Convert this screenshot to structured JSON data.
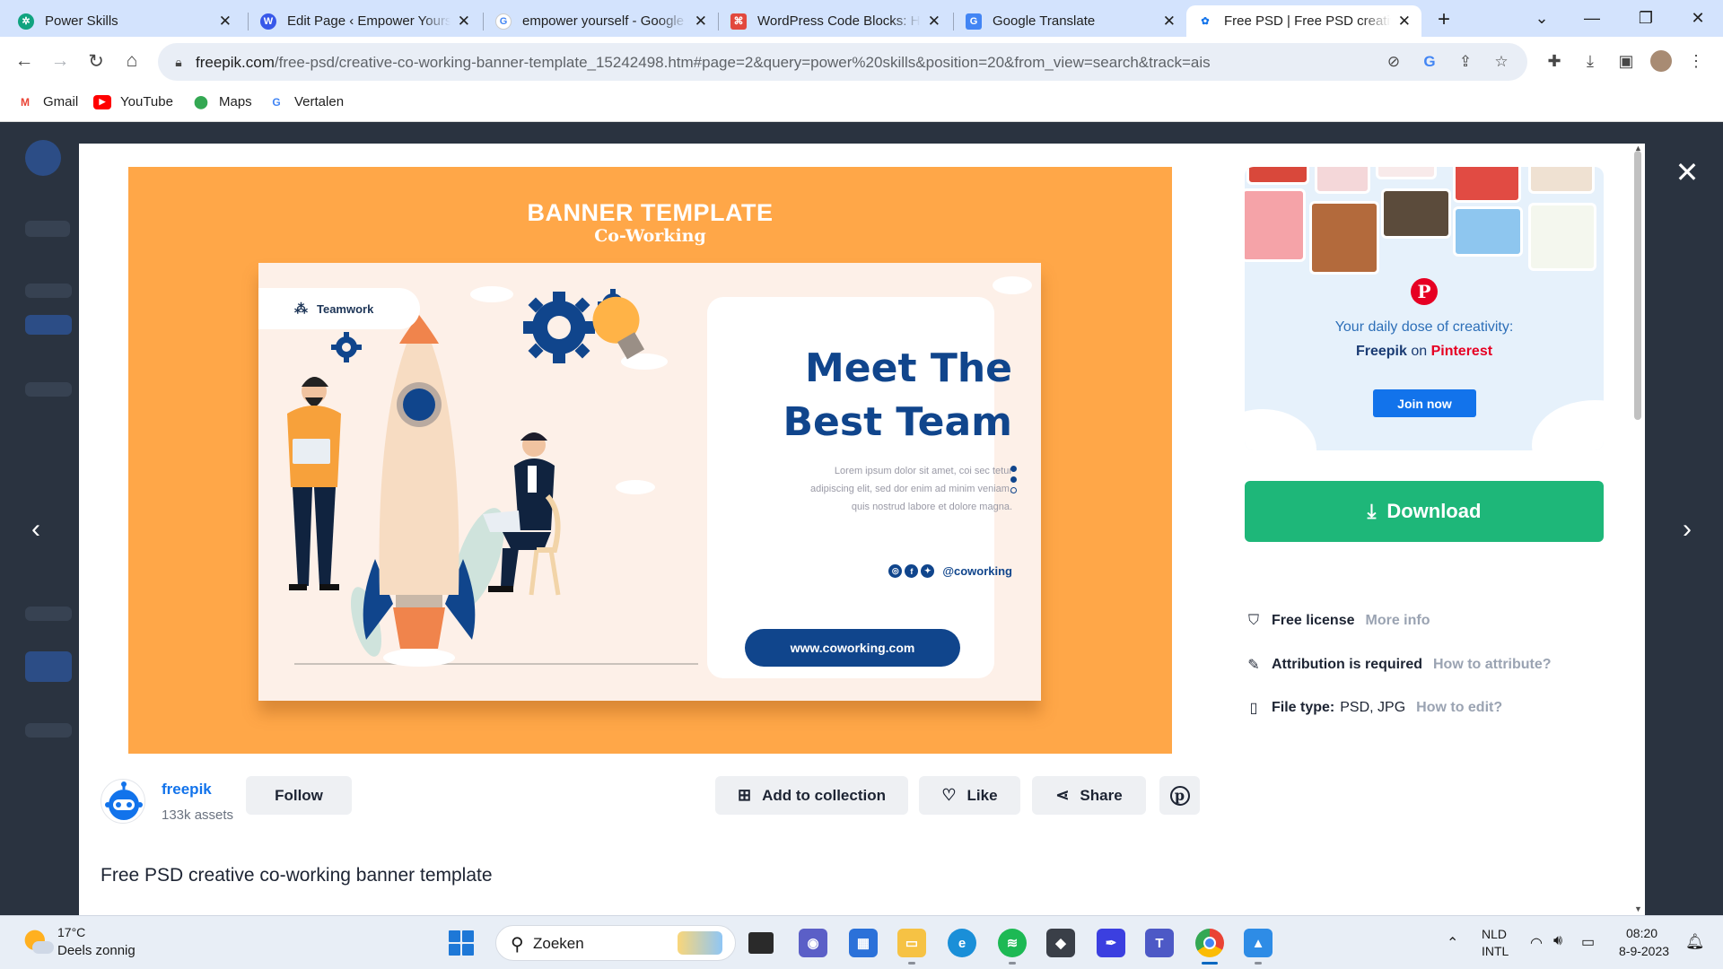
{
  "tabs": [
    {
      "title": "Power Skills",
      "icon": "chatgpt-icon",
      "color": "#10a37f",
      "glyph": "✲"
    },
    {
      "title": "Edit Page ‹ Empower Yourself",
      "icon": "wordpress-icon",
      "color": "#3858e9",
      "glyph": "W"
    },
    {
      "title": "empower yourself - Google Search",
      "icon": "google-icon",
      "color": "#4285f4",
      "glyph": "G"
    },
    {
      "title": "WordPress Code Blocks: How to",
      "icon": "code-blocks-icon",
      "color": "#e2483d",
      "glyph": "⌘"
    },
    {
      "title": "Google Translate",
      "icon": "translate-icon",
      "color": "#4285f4",
      "glyph": "G"
    },
    {
      "title": "Free PSD | Free PSD creative co-working",
      "icon": "freepik-icon",
      "color": "#1273eb",
      "glyph": "✿"
    }
  ],
  "address_bar": {
    "url_host": "freepik.com",
    "url_path": "/free-psd/creative-co-working-banner-template_15242498.htm#page=2&query=power%20skills&position=20&from_view=search&track=ais"
  },
  "bookmarks": [
    {
      "label": "Gmail",
      "icon": "gmail-icon",
      "color": "#ea4335",
      "glyph": "M"
    },
    {
      "label": "YouTube",
      "icon": "youtube-icon",
      "color": "#ff0000",
      "glyph": "▶"
    },
    {
      "label": "Maps",
      "icon": "maps-icon",
      "color": "#34a853",
      "glyph": "⬤"
    },
    {
      "label": "Vertalen",
      "icon": "translate-icon",
      "color": "#4285f4",
      "glyph": "G"
    }
  ],
  "banner": {
    "title": "BANNER TEMPLATE",
    "subtitle": "Co-Working",
    "teamwork": "Teamwork",
    "headline": "Meet The Best Team",
    "body": "Lorem ipsum dolor sit amet, coi sec tetur adipiscing elit, sed dor enim ad minim veniam, quis nostrud labore et dolore magna.",
    "handle": "@coworking",
    "website": "www.coworking.com"
  },
  "pinterest": {
    "line1": "Your daily dose of creativity:",
    "brand": "Freepik",
    "on": "on",
    "network": "Pinterest",
    "join": "Join now"
  },
  "download": {
    "label": "Download"
  },
  "meta": {
    "license": "Free license",
    "license_link": "More info",
    "attribution": "Attribution is required",
    "attribution_link": "How to attribute?",
    "filetype_label": "File type:",
    "filetype_value": "PSD, JPG",
    "filetype_link": "How to edit?"
  },
  "author": {
    "name": "freepik",
    "assets": "133k assets",
    "follow": "Follow"
  },
  "actions": {
    "collection": "Add to collection",
    "like": "Like",
    "share": "Share"
  },
  "resource_title": "Free PSD creative co-working banner template",
  "taskbar": {
    "temperature": "17°C",
    "weather": "Deels zonnig",
    "search": "Zoeken",
    "language": "NLD",
    "layout": "INTL",
    "time": "08:20",
    "date": "8-9-2023"
  },
  "colors": {
    "accent": "#1273eb",
    "download": "#1eb779",
    "pinterest": "#e60023",
    "banner_bg": "#ffa748",
    "navy": "#10458c"
  }
}
